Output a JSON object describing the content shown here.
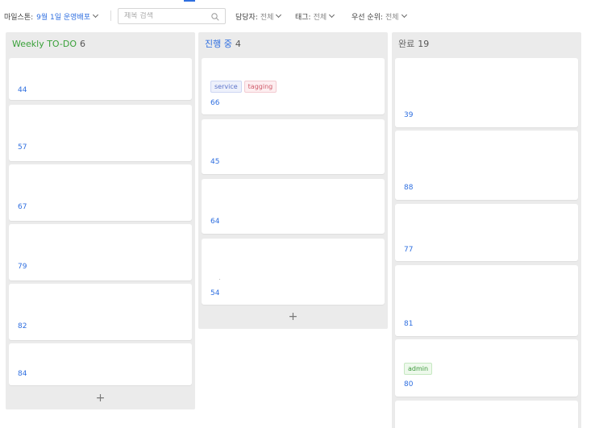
{
  "filters": {
    "milestone_label": "마일스톤:",
    "milestone_value": "9월 1일 운영배포",
    "search_placeholder": "제목 검색",
    "assignee_label": "담당자:",
    "assignee_value": "전체",
    "tag_label": "태그:",
    "tag_value": "전체",
    "priority_label": "우선 순위:",
    "priority_value": "전체"
  },
  "colors": {
    "accent": "#2f6fe0",
    "weekly_title": "#3aa13a",
    "progress_title": "#2f6fe0",
    "done_title": "#666666"
  },
  "columns": [
    {
      "title": "Weekly TO-DO",
      "count": "6",
      "add_label": "+",
      "cards": [
        {
          "number": "44"
        },
        {
          "number": "57"
        },
        {
          "number": "67"
        },
        {
          "number": "79"
        },
        {
          "number": "82"
        },
        {
          "number": "84"
        }
      ]
    },
    {
      "title": "진행 중",
      "count": "4",
      "add_label": "+",
      "cards": [
        {
          "number": "66",
          "tags": [
            "service",
            "tagging"
          ]
        },
        {
          "number": "45"
        },
        {
          "number": "64"
        },
        {
          "number": "54"
        }
      ]
    },
    {
      "title": "완료",
      "count": "19",
      "cards": [
        {
          "number": "39"
        },
        {
          "number": "88"
        },
        {
          "number": "77"
        },
        {
          "number": "81"
        },
        {
          "number": "80",
          "tags": [
            "admin"
          ]
        },
        {
          "number": ""
        }
      ]
    }
  ]
}
